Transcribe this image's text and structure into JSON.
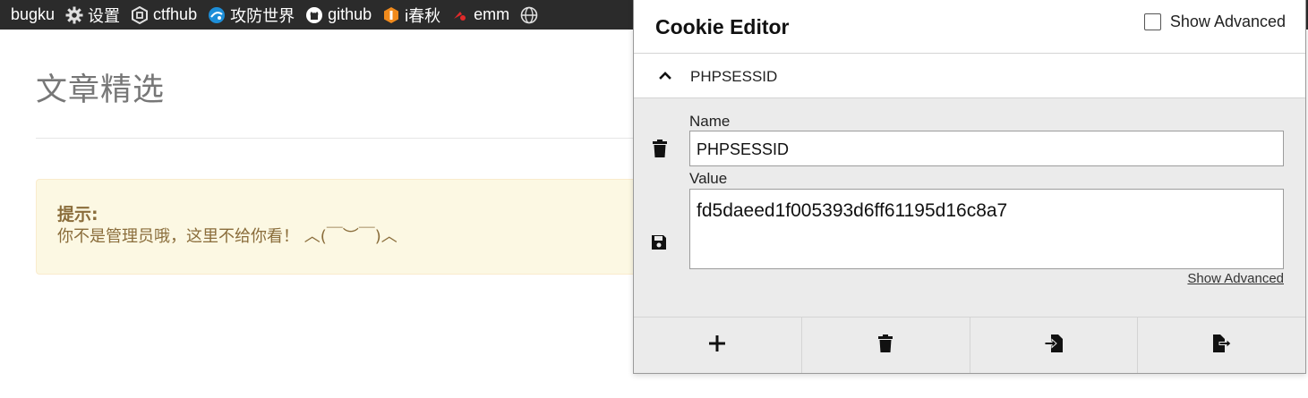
{
  "bookmarks": [
    {
      "label": "bugku",
      "icon": "none"
    },
    {
      "label": "设置",
      "icon": "gear-icon"
    },
    {
      "label": "ctfhub",
      "icon": "ctfhub-icon"
    },
    {
      "label": "攻防世界",
      "icon": "globe-blue-icon"
    },
    {
      "label": "github",
      "icon": "github-icon"
    },
    {
      "label": "i春秋",
      "icon": "ichunqiu-icon"
    },
    {
      "label": "emm",
      "icon": "emm-icon"
    },
    {
      "label": "",
      "icon": "globe-icon"
    }
  ],
  "page": {
    "title": "文章精选",
    "alert_title": "提示:",
    "alert_message": "你不是管理员哦，这里不给你看！ ︿(￣︶￣)︿"
  },
  "cookie_editor": {
    "title": "Cookie Editor",
    "show_advanced_label": "Show Advanced",
    "cookie_name_header": "PHPSESSID",
    "name_label": "Name",
    "name_value": "PHPSESSID",
    "value_label": "Value",
    "value_value": "fd5daeed1f005393d6ff61195d16c8a7",
    "show_advanced_link": "Show Advanced",
    "footer_buttons": [
      "add-icon",
      "trash-icon",
      "import-icon",
      "export-icon"
    ]
  },
  "colors": {
    "bookmarks_bg": "#2b2b2b",
    "alert_bg": "#fcf8e3",
    "alert_text": "#8a6d3b",
    "details_bg": "#ebebeb"
  }
}
